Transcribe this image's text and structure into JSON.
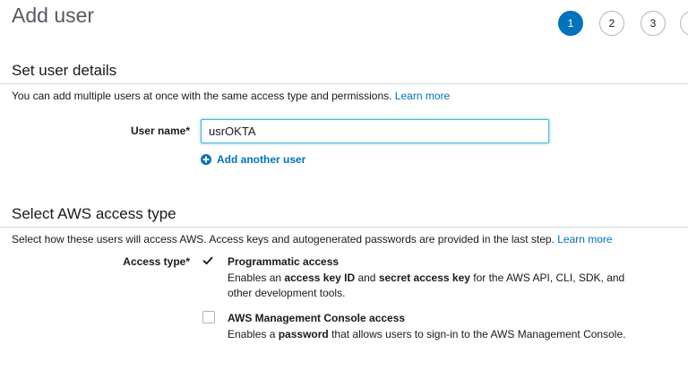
{
  "header": {
    "title": "Add user"
  },
  "steps": [
    {
      "label": "1",
      "active": true
    },
    {
      "label": "2",
      "active": false
    },
    {
      "label": "3",
      "active": false
    }
  ],
  "user_details": {
    "title": "Set user details",
    "description": "You can add multiple users at once with the same access type and permissions.",
    "learn_more": "Learn more",
    "user_name_label": "User name*",
    "user_name_value": "usrOKTA",
    "add_another_user": "Add another user"
  },
  "access_type": {
    "title": "Select AWS access type",
    "description": "Select how these users will access AWS. Access keys and autogenerated passwords are provided in the last step.",
    "learn_more": "Learn more",
    "label": "Access type*",
    "options": [
      {
        "title": "Programmatic access",
        "checked": true,
        "desc_pre": "Enables an ",
        "desc_b1": "access key ID",
        "desc_mid": " and ",
        "desc_b2": "secret access key",
        "desc_post": " for the AWS API, CLI, SDK, and other development tools."
      },
      {
        "title": "AWS Management Console access",
        "checked": false,
        "desc_pre": "Enables a ",
        "desc_b1": "password",
        "desc_post": " that allows users to sign-in to the AWS Management Console."
      }
    ]
  },
  "colors": {
    "primary": "#0073bb",
    "check": "#16191f",
    "border": "#aab7b8"
  }
}
